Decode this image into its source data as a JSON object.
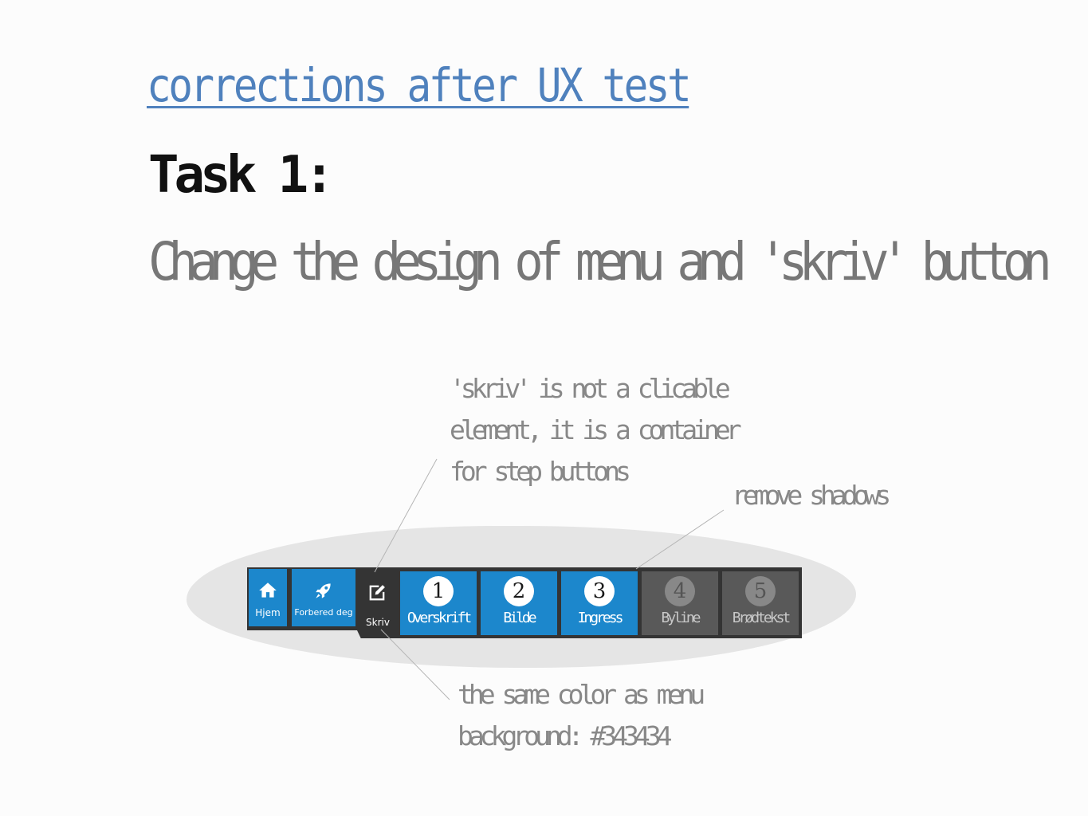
{
  "slide": {
    "title": "corrections after UX test",
    "task_heading": "Task 1:",
    "task_description": "Change the design of menu and 'skriv' button"
  },
  "colors": {
    "title": "#4f81bd",
    "menu_background": "#343434",
    "active_blue": "#1c87cc",
    "inactive_step": "#595959",
    "annotation_text": "#888888"
  },
  "annotations": {
    "skriv_note": [
      "'skriv' is not a clicable",
      "element, it is a container",
      "for step buttons"
    ],
    "shadows_note": "remove shadows",
    "color_note": [
      "the same color as menu",
      "background: #343434"
    ]
  },
  "menu": {
    "items": [
      {
        "label": "Hjem",
        "icon": "home-icon"
      },
      {
        "label": "Forbered deg",
        "icon": "rocket-icon"
      },
      {
        "label": "Skriv",
        "icon": "edit-icon"
      }
    ]
  },
  "steps": [
    {
      "number": "1",
      "label": "Overskrift",
      "state": "active"
    },
    {
      "number": "2",
      "label": "Bilde",
      "state": "active"
    },
    {
      "number": "3",
      "label": "Ingress",
      "state": "active"
    },
    {
      "number": "4",
      "label": "Byline",
      "state": "inactive"
    },
    {
      "number": "5",
      "label": "Brødtekst",
      "state": "inactive"
    }
  ]
}
